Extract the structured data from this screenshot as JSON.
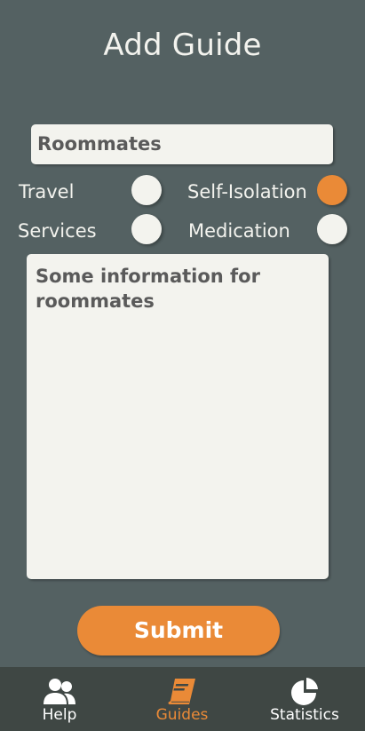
{
  "header": {
    "title": "Add Guide"
  },
  "form": {
    "title_value": "Roommates",
    "categories": [
      {
        "label": "Travel",
        "selected": false
      },
      {
        "label": "Self-Isolation",
        "selected": true
      },
      {
        "label": "Services",
        "selected": false
      },
      {
        "label": "Medication",
        "selected": false
      }
    ],
    "content_value": "Some information for roommates",
    "submit_label": "Submit"
  },
  "nav": {
    "items": [
      {
        "label": "Help",
        "icon": "people-icon",
        "active": false
      },
      {
        "label": "Guides",
        "icon": "book-icon",
        "active": true
      },
      {
        "label": "Statistics",
        "icon": "pie-chart-icon",
        "active": false
      }
    ]
  },
  "colors": {
    "background": "#546162",
    "accent": "#ea8a37",
    "field": "#f3f3ee",
    "nav_background": "#3f4744"
  }
}
